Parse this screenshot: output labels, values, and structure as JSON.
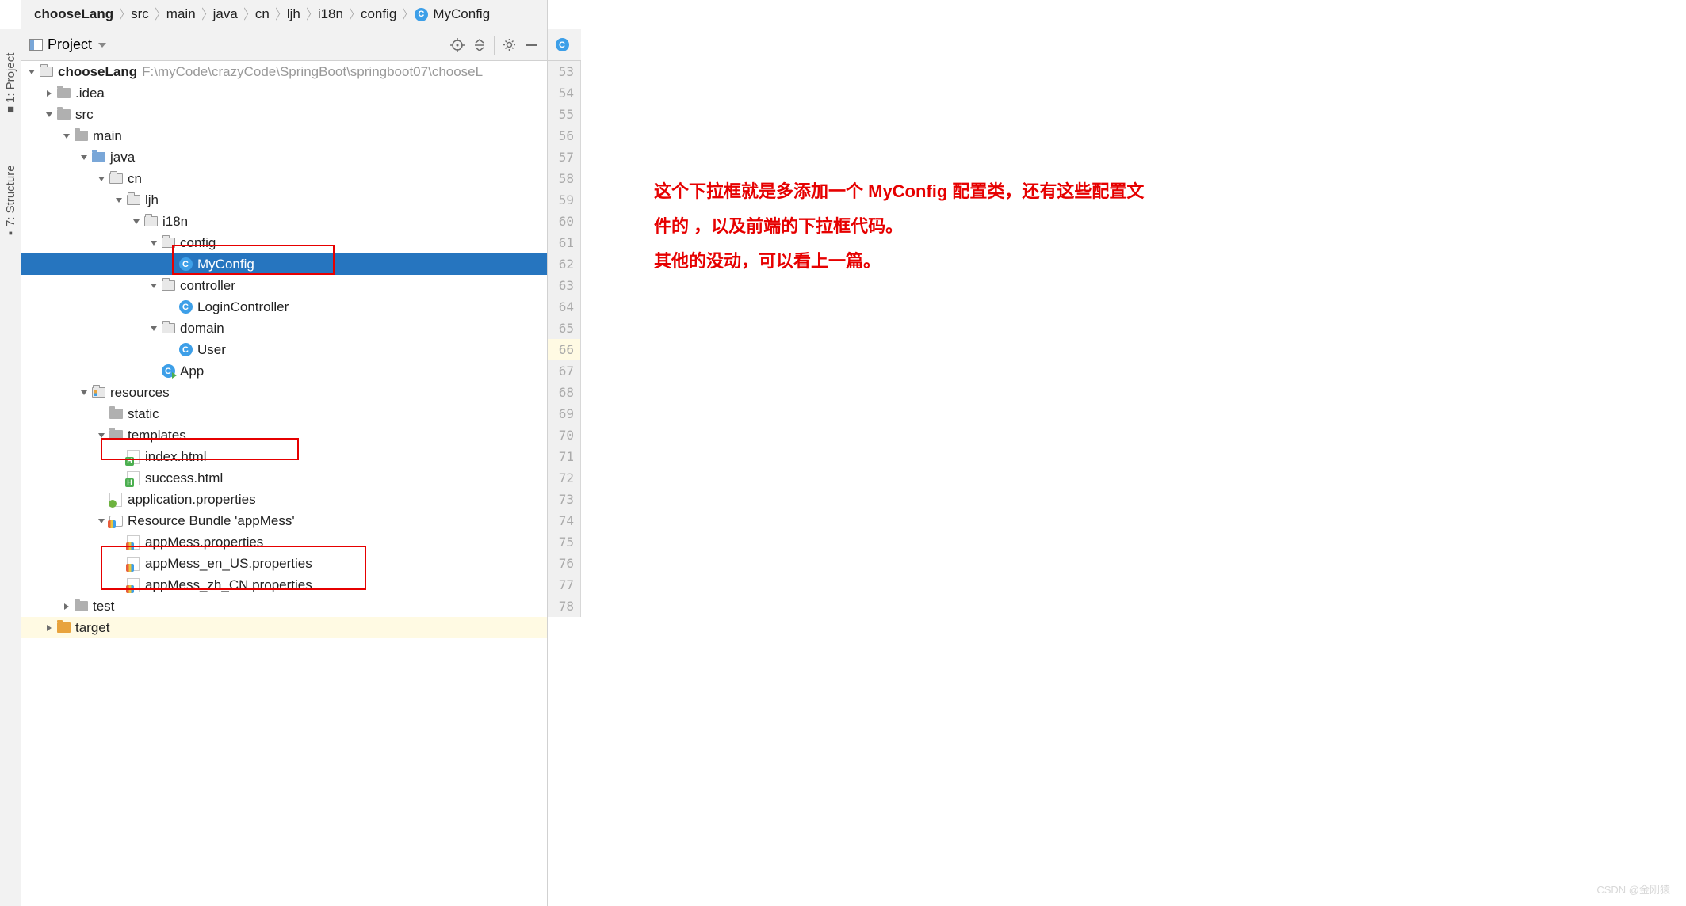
{
  "breadcrumb": [
    "chooseLang",
    "src",
    "main",
    "java",
    "cn",
    "ljh",
    "i18n",
    "config",
    "MyConfig"
  ],
  "toolbar": {
    "project_label": "Project"
  },
  "left_tabs": {
    "project": "1: Project",
    "structure": "7: Structure"
  },
  "tree": {
    "root": "chooseLang",
    "root_path": "F:\\myCode\\crazyCode\\SpringBoot\\springboot07\\chooseL",
    "idea": ".idea",
    "src": "src",
    "main": "main",
    "java": "java",
    "cn": "cn",
    "ljh": "ljh",
    "i18n": "i18n",
    "config": "config",
    "myconfig": "MyConfig",
    "controller": "controller",
    "logincontroller": "LoginController",
    "domain": "domain",
    "user": "User",
    "app": "App",
    "resources": "resources",
    "static": "static",
    "templates": "templates",
    "index_html": "index.html",
    "success_html": "success.html",
    "app_props": "application.properties",
    "bundle": "Resource Bundle 'appMess'",
    "appmess": "appMess.properties",
    "appmess_en": "appMess_en_US.properties",
    "appmess_zh": "appMess_zh_CN.properties",
    "test": "test",
    "target": "target"
  },
  "gutter": {
    "start": 53,
    "end": 78,
    "highlighted": 66
  },
  "annotation": {
    "line1": "这个下拉框就是多添加一个 MyConfig 配置类，还有这些配置文",
    "line2": "件的 ，以及前端的下拉框代码。",
    "line3": "其他的没动，可以看上一篇。"
  },
  "watermark": "CSDN @金刚猿"
}
